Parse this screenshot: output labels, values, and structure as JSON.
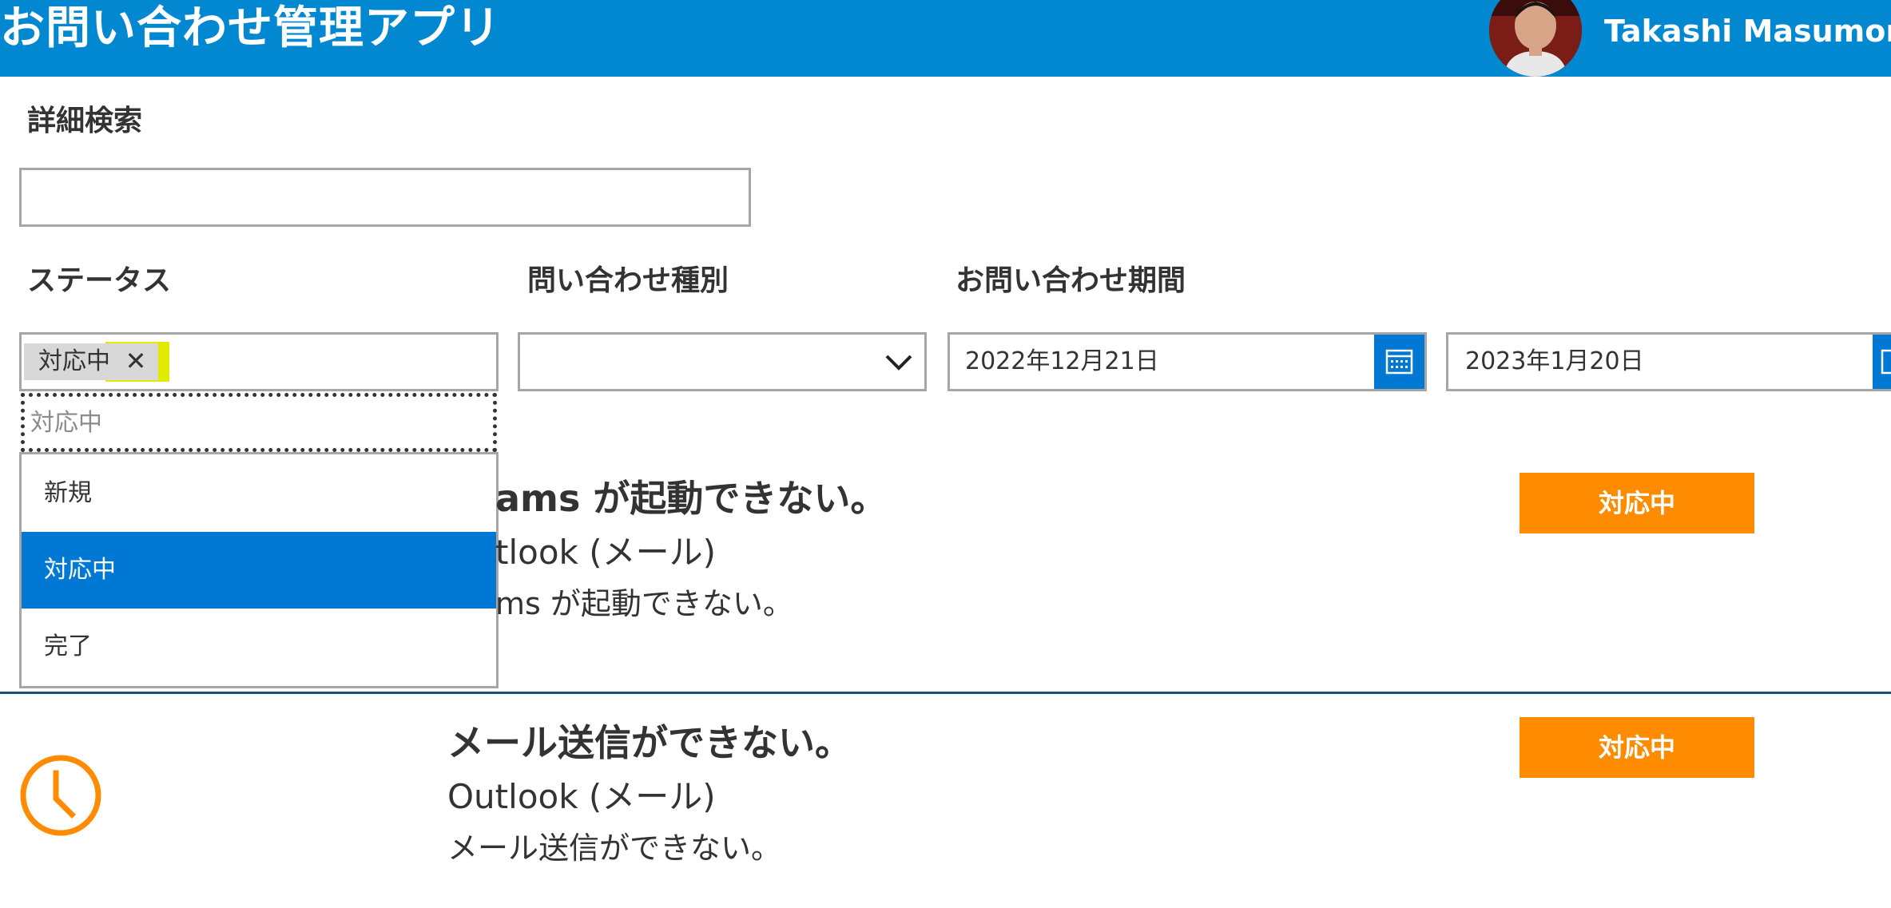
{
  "header": {
    "app_title": "お問い合わせ管理アプリ",
    "user_name": "Takashi Masumori",
    "accent": "#0288d1"
  },
  "search": {
    "label": "詳細検索",
    "value": ""
  },
  "filters": {
    "status_label": "ステータス",
    "type_label": "問い合わせ種別",
    "period_label": "お問い合わせ期間",
    "status_tag": "対応中",
    "status_tag_remove": "✕",
    "status_search_placeholder": "対応中",
    "status_options": [
      "新規",
      "対応中",
      "完了"
    ],
    "selected_status": "対応中",
    "type_value": "",
    "date_from": "2022年12月21日",
    "date_to": "2023年1月20日"
  },
  "items": [
    {
      "title": "ams が起動できない。",
      "category": "tlook (メール)",
      "description": "ms が起動できない。",
      "status": "対応中"
    },
    {
      "title": "メール送信ができない。",
      "category": "Outlook (メール)",
      "description": "メール送信ができない。",
      "status": "対応中",
      "icon": "clock-icon"
    }
  ],
  "colors": {
    "status_badge": "#ff8c00",
    "selected": "#0078d4",
    "highlight": "#e2ea00"
  }
}
